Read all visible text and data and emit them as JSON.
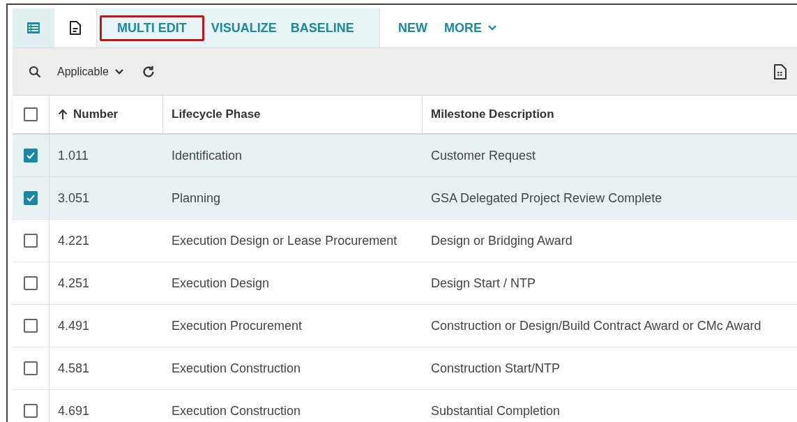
{
  "view_toggles": [
    {
      "kind": "list",
      "selected": true
    },
    {
      "kind": "document",
      "selected": false
    }
  ],
  "action_group": [
    {
      "label": "MULTI EDIT",
      "highlighted": true
    },
    {
      "label": "VISUALIZE",
      "highlighted": false
    },
    {
      "label": "BASELINE",
      "highlighted": false
    }
  ],
  "actions": [
    {
      "label": "NEW",
      "dropdown": false
    },
    {
      "label": "MORE",
      "dropdown": true
    }
  ],
  "toolbar": {
    "filter": "Applicable"
  },
  "table": {
    "select_all_checked": false,
    "columns": [
      {
        "label": "Number",
        "sorted_ascending": true
      },
      {
        "label": "Lifecycle Phase",
        "sorted_ascending": false
      },
      {
        "label": "Milestone Description",
        "sorted_ascending": false
      }
    ],
    "rows": [
      {
        "checked": true,
        "cells": [
          "1.011",
          "Identification",
          "Customer Request"
        ]
      },
      {
        "checked": true,
        "cells": [
          "3.051",
          "Planning",
          "GSA Delegated Project Review Complete"
        ]
      },
      {
        "checked": false,
        "cells": [
          "4.221",
          "Execution Design or Lease Procurement",
          "Design or Bridging Award"
        ]
      },
      {
        "checked": false,
        "cells": [
          "4.251",
          "Execution Design",
          "Design Start / NTP"
        ]
      },
      {
        "checked": false,
        "cells": [
          "4.491",
          "Execution Procurement",
          "Construction or Design/Build Contract Award or CMc Award"
        ]
      },
      {
        "checked": false,
        "cells": [
          "4.581",
          "Execution Construction",
          "Construction Start/NTP"
        ]
      },
      {
        "checked": false,
        "cells": [
          "4.691",
          "Execution Construction",
          "Substantial Completion"
        ]
      }
    ]
  }
}
